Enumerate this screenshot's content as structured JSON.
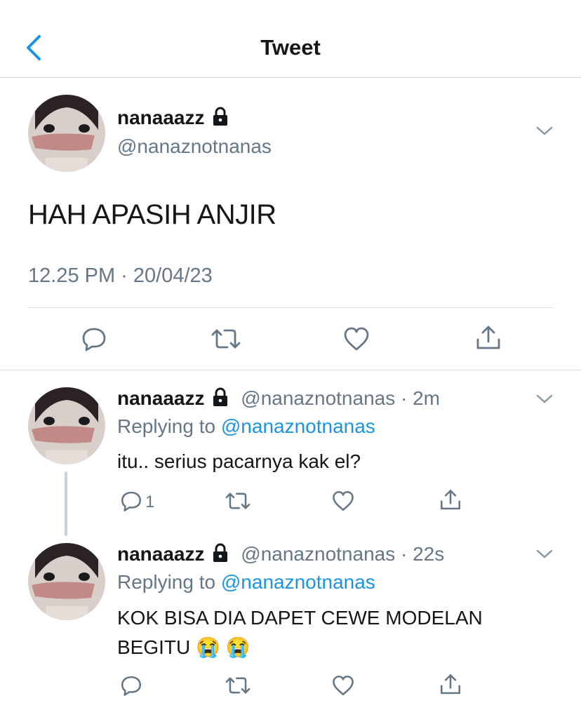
{
  "header": {
    "title": "Tweet",
    "back_icon": "chevron-left-icon",
    "accent": "#1b95e0"
  },
  "main_tweet": {
    "display_name": "nanaaazz",
    "handle": "@nanaznotnanas",
    "text": "HAH APASIH ANJIR",
    "timestamp": "12.25 PM · 20/04/23"
  },
  "replies": [
    {
      "display_name": "nanaaazz",
      "handle": "@nanaznotnanas",
      "time": "· 2m",
      "replying_label": "Replying to",
      "replying_handle": "@nanaznotnanas",
      "text": "itu.. serius pacarnya kak el?",
      "reply_count": "1"
    },
    {
      "display_name": "nanaaazz",
      "handle": "@nanaznotnanas",
      "time": "· 22s",
      "replying_label": "Replying to",
      "replying_handle": "@nanaznotnanas",
      "text_line1": "KOK BISA DIA DAPET CEWE MODELAN",
      "text_line2": "BEGITU",
      "emoji": "😭 😭"
    }
  ]
}
